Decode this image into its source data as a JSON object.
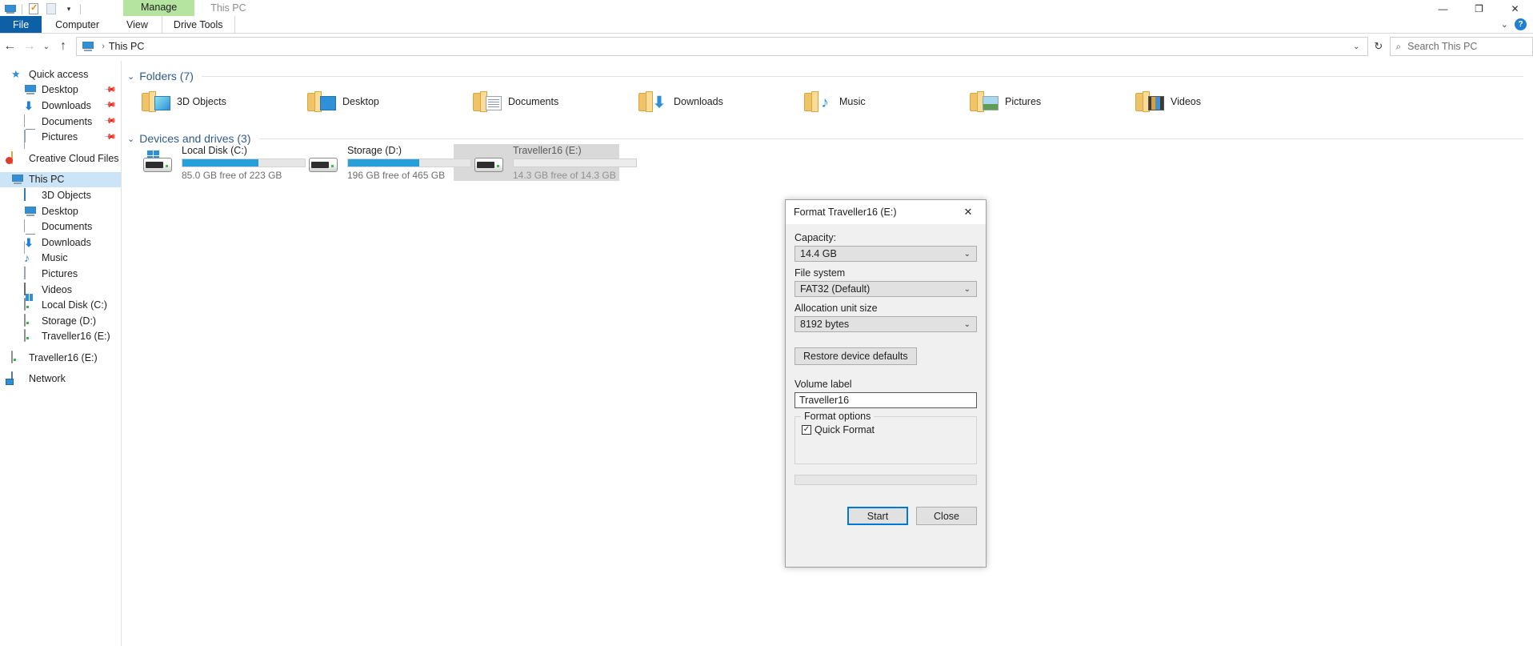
{
  "window": {
    "title": "This PC",
    "quick_access_toolbar": [
      {
        "name": "this-pc-icon",
        "tooltip": "This PC"
      },
      {
        "name": "properties-icon",
        "tooltip": "Properties"
      },
      {
        "name": "new-folder-icon",
        "tooltip": "New folder"
      },
      {
        "name": "customize-chevron-icon",
        "glyph": "▾"
      }
    ],
    "controls": {
      "minimize": "—",
      "maximize": "❐",
      "close": "✕"
    }
  },
  "ribbon": {
    "contextual_group": "Manage",
    "tabs": [
      {
        "label": "File",
        "active": false,
        "style": "file"
      },
      {
        "label": "Computer",
        "active": false
      },
      {
        "label": "View",
        "active": false
      },
      {
        "label": "Drive Tools",
        "active": true,
        "contextual": true
      }
    ],
    "collapse_chevron": "⌄",
    "help_glyph": "?"
  },
  "navbar": {
    "back": "←",
    "forward": "→",
    "recent": "⌄",
    "up": "↑",
    "breadcrumb": {
      "icon": "this-pc-icon",
      "separator": "›",
      "path": "This PC"
    },
    "history_chevron": "⌄",
    "refresh": "↻",
    "search": {
      "icon": "search-icon",
      "placeholder": "Search This PC",
      "value": ""
    }
  },
  "sidebar": {
    "groups": [
      {
        "header": {
          "label": "Quick access",
          "icon": "star-pin-icon",
          "level": 0
        },
        "items": [
          {
            "label": "Desktop",
            "icon": "monitor-icon",
            "pinned": true,
            "level": 1
          },
          {
            "label": "Downloads",
            "icon": "download-arrow-icon",
            "pinned": true,
            "level": 1
          },
          {
            "label": "Documents",
            "icon": "document-icon",
            "pinned": true,
            "level": 1
          },
          {
            "label": "Pictures",
            "icon": "picture-icon",
            "pinned": true,
            "level": 1
          }
        ]
      },
      {
        "header": {
          "label": "Creative Cloud Files",
          "icon": "creative-cloud-icon",
          "level": 0
        },
        "items": []
      },
      {
        "header": {
          "label": "This PC",
          "icon": "monitor-icon",
          "level": 0,
          "selected": true
        },
        "items": [
          {
            "label": "3D Objects",
            "icon": "cube-icon",
            "level": 1
          },
          {
            "label": "Desktop",
            "icon": "monitor-icon",
            "level": 1
          },
          {
            "label": "Documents",
            "icon": "document-icon",
            "level": 1
          },
          {
            "label": "Downloads",
            "icon": "download-arrow-icon",
            "level": 1
          },
          {
            "label": "Music",
            "icon": "music-note-icon",
            "level": 1
          },
          {
            "label": "Pictures",
            "icon": "picture-icon",
            "level": 1
          },
          {
            "label": "Videos",
            "icon": "video-icon",
            "level": 1
          },
          {
            "label": "Local Disk (C:)",
            "icon": "windows-drive-icon",
            "level": 1
          },
          {
            "label": "Storage (D:)",
            "icon": "drive-icon",
            "level": 1
          },
          {
            "label": "Traveller16 (E:)",
            "icon": "drive-icon",
            "level": 1
          }
        ]
      },
      {
        "header": {
          "label": "Traveller16 (E:)",
          "icon": "drive-icon",
          "level": 0
        },
        "items": []
      },
      {
        "header": {
          "label": "Network",
          "icon": "network-icon",
          "level": 0
        },
        "items": []
      }
    ]
  },
  "content": {
    "folders_group": {
      "title": "Folders (7)",
      "chevron": "⌄",
      "items": [
        {
          "label": "3D Objects",
          "icon": "folder-3d-objects-icon"
        },
        {
          "label": "Desktop",
          "icon": "folder-desktop-icon"
        },
        {
          "label": "Documents",
          "icon": "folder-documents-icon"
        },
        {
          "label": "Downloads",
          "icon": "folder-downloads-icon"
        },
        {
          "label": "Music",
          "icon": "folder-music-icon"
        },
        {
          "label": "Pictures",
          "icon": "folder-pictures-icon"
        },
        {
          "label": "Videos",
          "icon": "folder-videos-icon"
        }
      ]
    },
    "devices_group": {
      "title": "Devices and drives (3)",
      "chevron": "⌄",
      "items": [
        {
          "name": "Local Disk (C:)",
          "icon": "windows-drive-icon",
          "usage_text": "85.0 GB free of 223 GB",
          "used_percent": 62,
          "bar_color": "#26a0da",
          "selected": false
        },
        {
          "name": "Storage (D:)",
          "icon": "drive-icon",
          "usage_text": "196 GB free of 465 GB",
          "used_percent": 58,
          "bar_color": "#26a0da",
          "selected": false
        },
        {
          "name": "Traveller16 (E:)",
          "icon": "drive-icon",
          "usage_text": "14.3 GB free of 14.3 GB",
          "used_percent": 0,
          "bar_color": "#26a0da",
          "selected": true
        }
      ]
    }
  },
  "dialog": {
    "title": "Format Traveller16 (E:)",
    "close_glyph": "✕",
    "capacity": {
      "label": "Capacity:",
      "value": "14.4 GB",
      "chevron": "⌄"
    },
    "file_system": {
      "label": "File system",
      "value": "FAT32 (Default)",
      "chevron": "⌄"
    },
    "allocation_unit": {
      "label": "Allocation unit size",
      "value": "8192 bytes",
      "chevron": "⌄"
    },
    "restore_defaults_label": "Restore device defaults",
    "volume_label": {
      "label": "Volume label",
      "value": "Traveller16"
    },
    "format_options": {
      "legend": "Format options",
      "quick_format": {
        "label": "Quick Format",
        "checked": true,
        "check_glyph": "✓"
      }
    },
    "progress_percent": 0,
    "buttons": {
      "start": "Start",
      "close": "Close"
    }
  },
  "colors": {
    "accent": "#0078d7",
    "file_tab": "#0d5fa6",
    "contextual_tab": "#b5e3a0",
    "group_header": "#2f5a8c",
    "progress_blue": "#26a0da",
    "selection": "#cce4f7",
    "drive_selected": "#d9d9d9"
  }
}
